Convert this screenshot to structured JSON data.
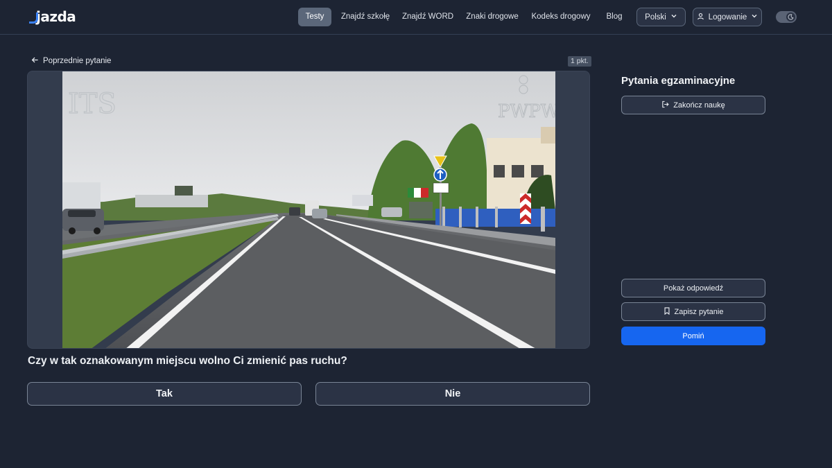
{
  "brand": {
    "name": "jazda"
  },
  "nav": {
    "items": [
      {
        "label": "Testy",
        "active": true
      },
      {
        "label": "Znajdź szkołę",
        "active": false
      },
      {
        "label": "Znajdź WORD",
        "active": false
      },
      {
        "label": "Znaki drogowe",
        "active": false
      },
      {
        "label": "Kodeks drogowy",
        "active": false
      },
      {
        "label": "Blog",
        "active": false
      }
    ],
    "language": "Polski",
    "login": "Logowanie",
    "theme_icon": "moon-icon"
  },
  "question": {
    "back_label": "Poprzednie pytanie",
    "points": "1 pkt.",
    "text": "Czy w tak oznakowanym miejscu wolno Ci zmienić pas ruchu?",
    "watermark": "PWPW",
    "answers": [
      "Tak",
      "Nie"
    ]
  },
  "sidebar": {
    "title": "Pytania egzaminacyjne",
    "end_label": "Zakończ naukę",
    "show_answer_label": "Pokaż odpowiedź",
    "save_label": "Zapisz pytanie",
    "skip_label": "Pomiń"
  },
  "colors": {
    "background": "#1d2433",
    "accent": "#1666f0",
    "active_tab": "#5b677a"
  }
}
